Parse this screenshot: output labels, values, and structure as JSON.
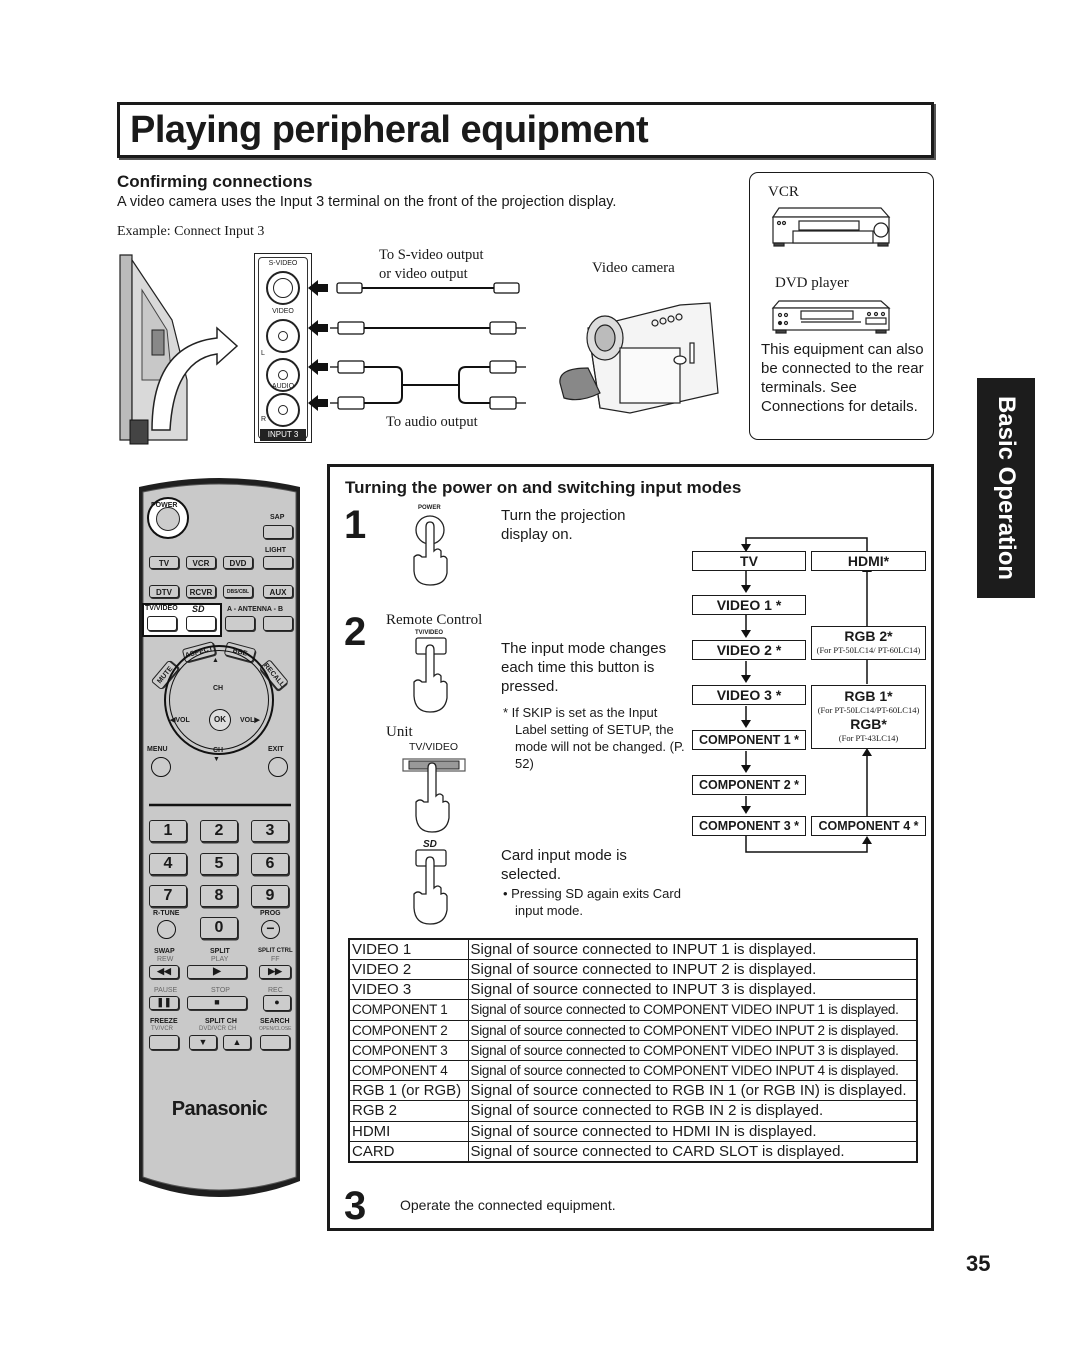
{
  "page": {
    "title": "Playing peripheral equipment",
    "page_number": "35",
    "side_tab": "Basic Operation"
  },
  "confirming": {
    "heading": "Confirming connections",
    "description": "A video camera uses the Input 3 terminal on the front of the projection display.",
    "example": "Example: Connect Input 3",
    "panel": {
      "s_video": "S-VIDEO",
      "video": "VIDEO",
      "l": "L",
      "audio": "AUDIO",
      "r": "R",
      "input_label": "INPUT 3"
    },
    "cable_label_top_1": "To S-video output",
    "cable_label_top_2": "or video output",
    "cable_label_bottom": "To audio output",
    "camera_label": "Video camera",
    "equipment_box": {
      "vcr": "VCR",
      "dvd": "DVD player",
      "note": "This equipment can also be connected to the rear terminals. See Connections for details."
    }
  },
  "remote": {
    "power": "POWER",
    "sap": "SAP",
    "light": "LIGHT",
    "row1": [
      "TV",
      "VCR",
      "DVD"
    ],
    "row2": [
      "DTV",
      "RCVR",
      "DBS/CBL",
      "AUX"
    ],
    "tv_video": "TV/VIDEO",
    "sd": "SD",
    "antenna": "A - ANTENNA - B",
    "mute": "MUTE",
    "aspect": "ASPECT",
    "bbe": "BBE",
    "recall": "RECALL",
    "ch": "CH",
    "vol_left": "VOL",
    "vol_right": "VOL",
    "ok": "OK",
    "menu": "MENU",
    "exit": "EXIT",
    "digits": [
      "1",
      "2",
      "3",
      "4",
      "5",
      "6",
      "7",
      "8",
      "9",
      "0"
    ],
    "r_tune": "R-TUNE",
    "prog": "PROG",
    "swap": "SWAP",
    "rew": "REW",
    "split": "SPLIT",
    "play": "PLAY",
    "split_ctrl": "SPLIT CTRL",
    "ff": "FF",
    "pause": "PAUSE",
    "stop": "STOP",
    "rec": "REC",
    "freeze": "FREEZE",
    "tv_vcr": "TV/VCR",
    "split_ch": "SPLIT CH",
    "dvd_vcr_ch": "DVD/VCR CH",
    "search": "SEARCH",
    "open_close": "OPEN/CLOSE",
    "brand": "Panasonic"
  },
  "power_section": {
    "heading": "Turning the power on and switching input modes",
    "step1": {
      "number": "1",
      "button_label": "POWER",
      "text": "Turn the projection display on."
    },
    "step2": {
      "number": "2",
      "remote_label": "Remote Control",
      "remote_button": "TV/VIDEO",
      "unit_label": "Unit",
      "unit_button": "TV/VIDEO",
      "text": "The input mode changes each time this button is pressed.",
      "note": "* If SKIP is set as the Input Label setting of SETUP, the mode will not be changed. (P. 52)",
      "sd_text": "Card input mode is selected.",
      "sd_note": "• Pressing SD again exits Card input mode."
    },
    "flow": {
      "tv": "TV",
      "hdmi": "HDMI*",
      "video1": "VIDEO 1 *",
      "video2": "VIDEO 2 *",
      "video3": "VIDEO 3 *",
      "component1": "COMPONENT 1 *",
      "component2": "COMPONENT 2 *",
      "component3": "COMPONENT 3 *",
      "component4": "COMPONENT 4 *",
      "rgb2": "RGB 2*",
      "rgb2_sub": "(For PT-50LC14/ PT-60LC14)",
      "rgb1": "RGB 1*",
      "rgb1_sub": "(For PT-50LC14/PT-60LC14)",
      "rgb": "RGB*",
      "rgb_sub": "(For PT-43LC14)"
    },
    "table": [
      {
        "mode": "VIDEO 1",
        "desc": "Signal of source connected to INPUT 1 is displayed."
      },
      {
        "mode": "VIDEO 2",
        "desc": "Signal of source connected to INPUT 2 is displayed."
      },
      {
        "mode": "VIDEO 3",
        "desc": "Signal of source connected to INPUT 3 is displayed."
      },
      {
        "mode": "COMPONENT 1",
        "desc": "Signal of source connected to COMPONENT VIDEO INPUT 1 is displayed."
      },
      {
        "mode": "COMPONENT 2",
        "desc": "Signal of source connected to COMPONENT VIDEO INPUT 2 is displayed."
      },
      {
        "mode": "COMPONENT 3",
        "desc": "Signal of source connected to COMPONENT VIDEO INPUT 3 is displayed."
      },
      {
        "mode": "COMPONENT 4",
        "desc": "Signal of source connected to COMPONENT VIDEO INPUT 4 is displayed."
      },
      {
        "mode": "RGB 1 (or RGB)",
        "desc": "Signal of source connected to RGB IN 1 (or RGB IN) is displayed."
      },
      {
        "mode": "RGB 2",
        "desc": "Signal of source connected to RGB IN 2  is displayed."
      },
      {
        "mode": "HDMI",
        "desc": "Signal of source connected to HDMI IN is displayed."
      },
      {
        "mode": "CARD",
        "desc": "Signal of source connected to CARD SLOT is displayed."
      }
    ],
    "step3": {
      "number": "3",
      "text": "Operate the connected equipment."
    }
  }
}
